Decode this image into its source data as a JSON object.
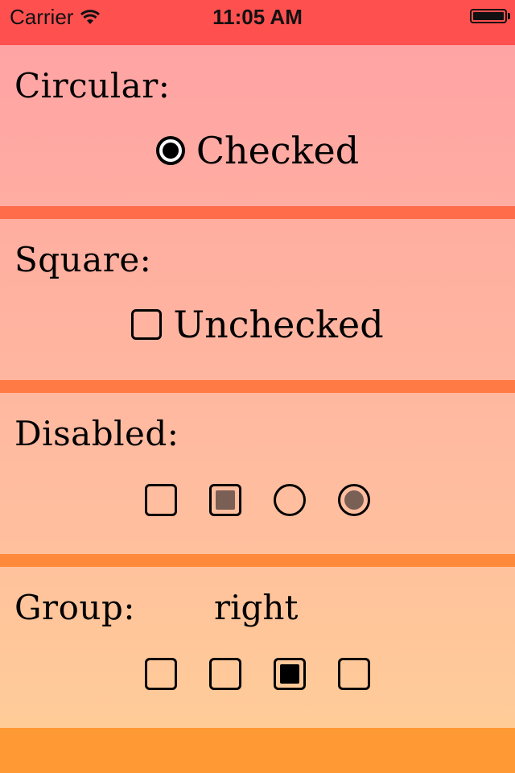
{
  "status_bar": {
    "carrier": "Carrier",
    "time": "11:05 AM",
    "wifi_icon": "wifi-icon",
    "battery_icon": "battery-icon"
  },
  "circular": {
    "title": "Circular:",
    "checkbox_label": "Checked",
    "checked": true
  },
  "square": {
    "title": "Square:",
    "checkbox_label": "Unchecked",
    "checked": false
  },
  "disabled": {
    "title": "Disabled:",
    "items": [
      {
        "style": "square",
        "checked": false
      },
      {
        "style": "square",
        "checked": true
      },
      {
        "style": "circle",
        "checked": false
      },
      {
        "style": "circle",
        "checked": true
      }
    ]
  },
  "group": {
    "title": "Group:",
    "selected_value": "right",
    "items": [
      {
        "style": "square",
        "checked": false
      },
      {
        "style": "square",
        "checked": false
      },
      {
        "style": "square",
        "checked": true
      },
      {
        "style": "square",
        "checked": false
      }
    ]
  },
  "colors": {
    "status_bar": "#ff5050",
    "disabled_control": "#7a5f55",
    "bottom_bar": "#ff9933"
  }
}
